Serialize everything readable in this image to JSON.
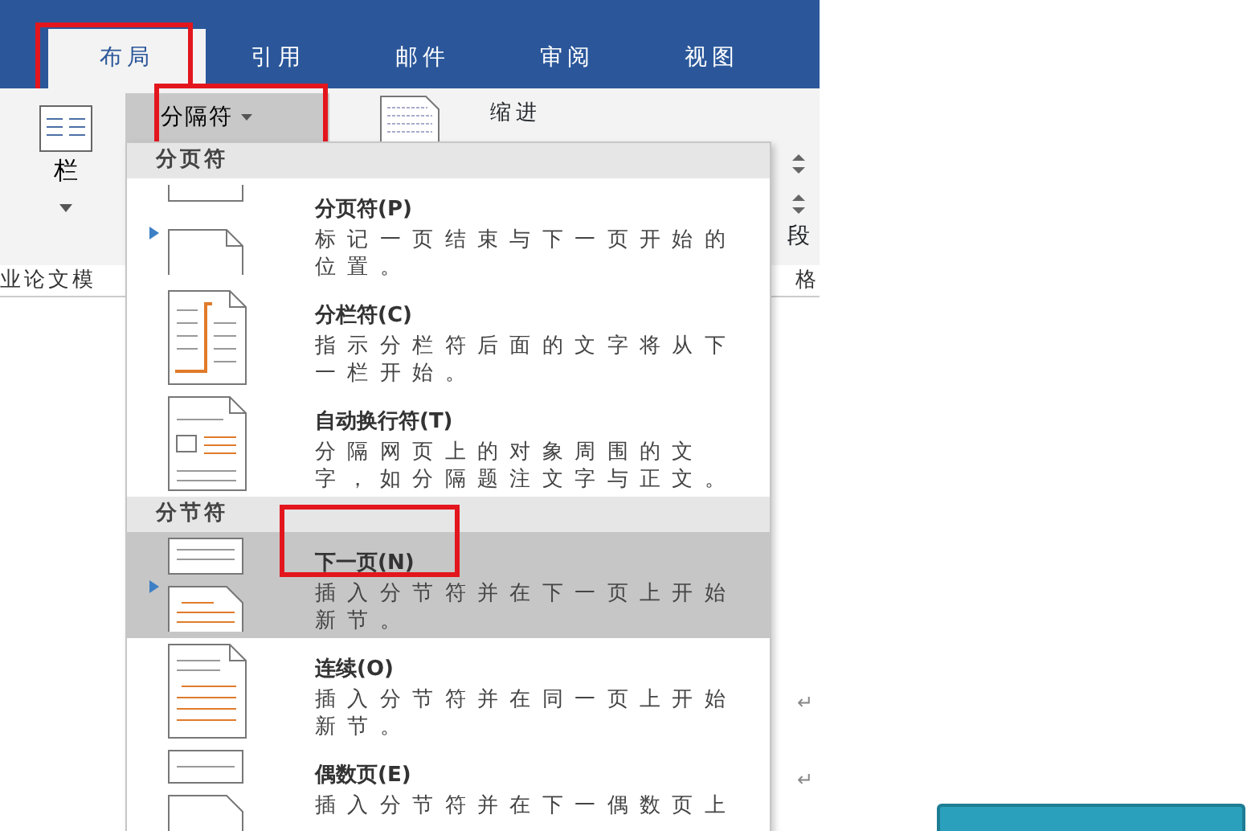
{
  "tabs": [
    {
      "label": "布局",
      "selected": true,
      "annotated": true
    },
    {
      "label": "引用",
      "selected": false,
      "annotated": false
    },
    {
      "label": "邮件",
      "selected": false,
      "annotated": false
    },
    {
      "label": "审阅",
      "selected": false,
      "annotated": false
    },
    {
      "label": "视图",
      "selected": false,
      "annotated": false
    }
  ],
  "ribbon": {
    "columns_button": {
      "label": "栏"
    },
    "breaks_button": {
      "label": "分隔符",
      "expanded": true,
      "annotated": true
    },
    "indent_label": "缩进",
    "paragraph_label": "段"
  },
  "document": {
    "left_text": "业论文模",
    "right_text": "格",
    "paragraph_marks": [
      "↵",
      "↵"
    ]
  },
  "breaks_menu": {
    "sections": [
      {
        "heading": "分页符",
        "items": [
          {
            "kind": "page",
            "title": "分页符(P)",
            "description": "标记一页结束与下一页开始的位置。",
            "selected": false,
            "marker": true,
            "annotated": false
          },
          {
            "kind": "column",
            "title": "分栏符(C)",
            "description": "指示分栏符后面的文字将从下一栏开始。",
            "selected": false,
            "marker": false,
            "annotated": false
          },
          {
            "kind": "wrap",
            "title": "自动换行符(T)",
            "description": "分隔网页上的对象周围的文字，如分隔题注文字与正文。",
            "selected": false,
            "marker": false,
            "annotated": false
          }
        ]
      },
      {
        "heading": "分节符",
        "items": [
          {
            "kind": "next",
            "title": "下一页(N)",
            "description": "插入分节符并在下一页上开始新节。",
            "selected": true,
            "marker": true,
            "annotated": true
          },
          {
            "kind": "continuous",
            "title": "连续(O)",
            "description": "插入分节符并在同一页上开始新节。",
            "selected": false,
            "marker": false,
            "annotated": false
          },
          {
            "kind": "even",
            "title": "偶数页(E)",
            "description": "插入分节符并在下一偶数页上",
            "selected": false,
            "marker": false,
            "annotated": false
          }
        ]
      }
    ]
  }
}
